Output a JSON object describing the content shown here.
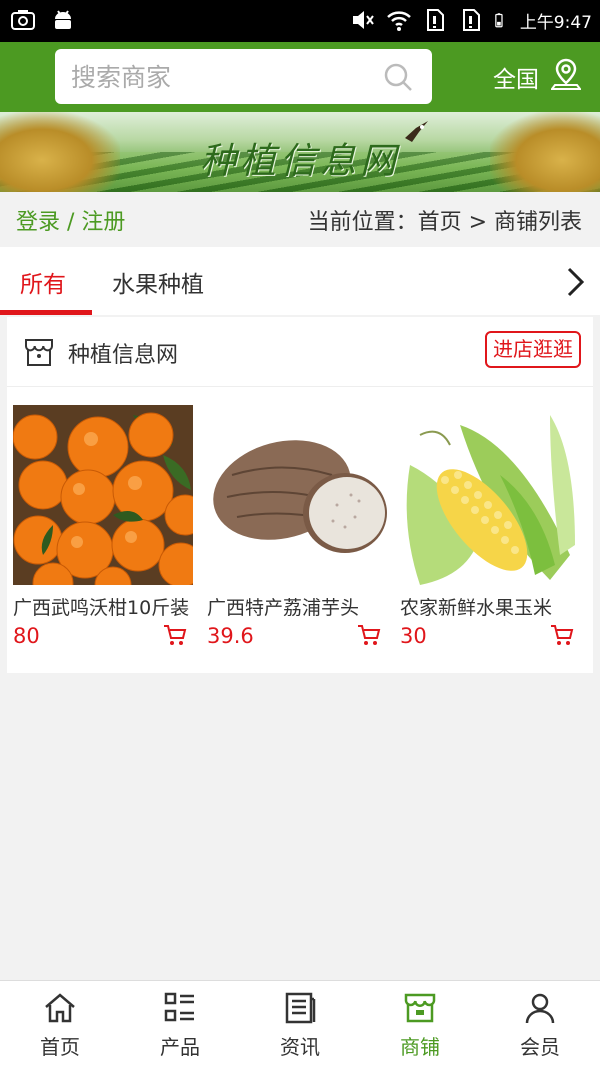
{
  "status_bar": {
    "time": "上午9:47"
  },
  "header": {
    "search_placeholder": "搜索商家",
    "region_label": "全国"
  },
  "banner": {
    "title": "种植信息网"
  },
  "location_bar": {
    "login_link": "登录 / 注册",
    "breadcrumb": "当前位置：首页 > 商铺列表"
  },
  "tabs": [
    {
      "label": "所有",
      "active": true
    },
    {
      "label": "水果种植",
      "active": false
    }
  ],
  "shop": {
    "name": "种植信息网",
    "visit_button": "进店逛逛",
    "products": [
      {
        "name": "广西武鸣沃柑10斤装",
        "price": "80"
      },
      {
        "name": "广西特产荔浦芋头",
        "price": "39.6"
      },
      {
        "name": "农家新鲜水果玉米",
        "price": "30"
      }
    ]
  },
  "bottom_nav": [
    {
      "label": "首页",
      "icon": "home-icon",
      "active": false
    },
    {
      "label": "产品",
      "icon": "list-icon",
      "active": false
    },
    {
      "label": "资讯",
      "icon": "news-icon",
      "active": false
    },
    {
      "label": "商铺",
      "icon": "shop-icon",
      "active": true
    },
    {
      "label": "会员",
      "icon": "user-icon",
      "active": false
    }
  ],
  "colors": {
    "brand_green": "#4c9a22",
    "accent_red": "#e0161b"
  }
}
